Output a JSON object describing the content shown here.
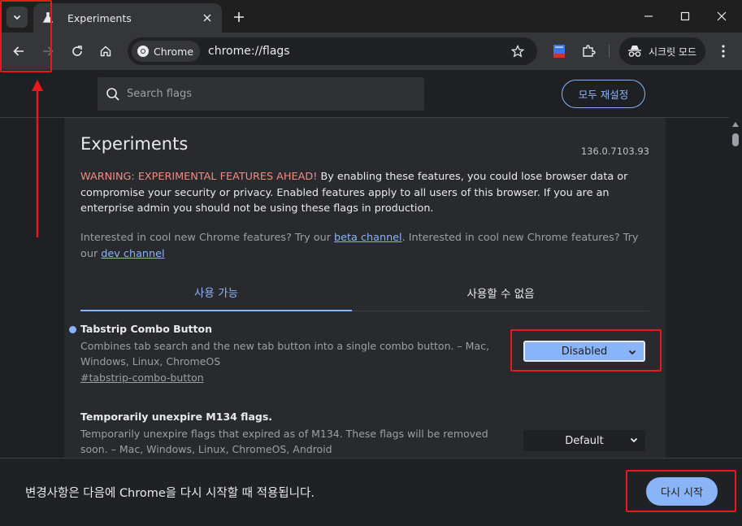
{
  "browser": {
    "tab_title": "Experiments",
    "chip_label": "Chrome",
    "url": "chrome://flags",
    "incognito_label": "시크릿 모드"
  },
  "header": {
    "search_placeholder": "Search flags",
    "reset_label": "모두 재설정"
  },
  "page": {
    "title": "Experiments",
    "version": "136.0.7103.93",
    "warning_prefix": "WARNING: EXPERIMENTAL FEATURES AHEAD!",
    "warning_text": " By enabling these features, you could lose browser data or compromise your security or privacy. Enabled features apply to all users of this browser. If you are an enterprise admin you should not be using these flags in production.",
    "interest_text_1": "Interested in cool new Chrome features? Try our ",
    "beta_link": "beta channel",
    "interest_text_2": ". Interested in cool new Chrome features? Try our ",
    "dev_link": "dev channel",
    "tabs": [
      "사용 가능",
      "사용할 수 없음"
    ]
  },
  "flags": [
    {
      "name": "Tabstrip Combo Button",
      "description": "Combines tab search and the new tab button into a single combo button. – Mac, Windows, Linux, ChromeOS",
      "anchor": "#tabstrip-combo-button",
      "value": "Disabled"
    },
    {
      "name": "Temporarily unexpire M134 flags.",
      "description": "Temporarily unexpire flags that expired as of M134. These flags will be removed soon. – Mac, Windows, Linux, ChromeOS, Android",
      "value": "Default"
    }
  ],
  "bottom_bar": {
    "message": "변경사항은 다음에 Chrome을 다시 시작할 때 적용됩니다.",
    "relaunch_label": "다시 시작"
  },
  "colors": {
    "accent": "#8ab4f8",
    "warning": "#f28b82",
    "annotation": "#e8191c"
  }
}
